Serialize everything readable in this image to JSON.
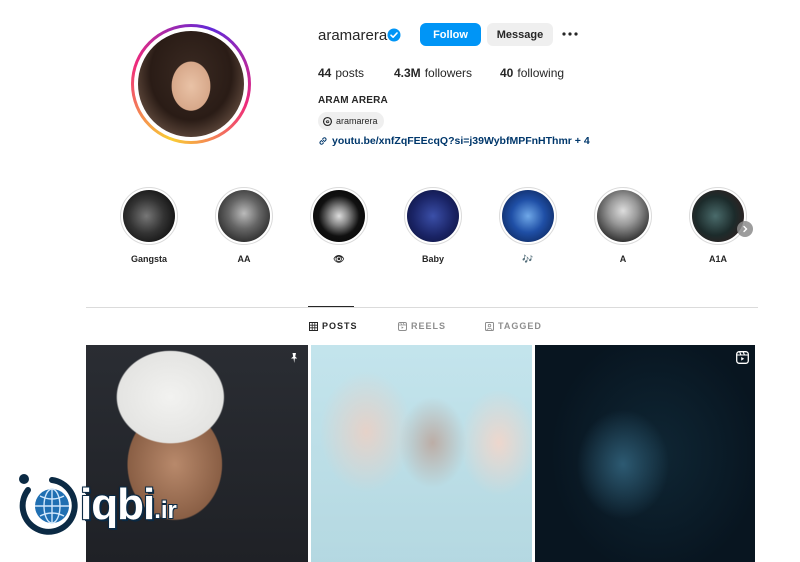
{
  "profile": {
    "username": "aramarera",
    "verified": true,
    "follow_label": "Follow",
    "message_label": "Message",
    "stats": {
      "posts_count": "44",
      "posts_label": "posts",
      "followers_count": "4.3M",
      "followers_label": "followers",
      "following_count": "40",
      "following_label": "following"
    },
    "full_name": "ARAM ARERA",
    "threads_handle": "aramarera",
    "bio_link": "youtu.be/xnfZqFEEcqQ?si=j39WybfMPFnHThmr + 4"
  },
  "highlights": [
    {
      "label": "Gangsta"
    },
    {
      "label": "AA"
    },
    {
      "label": "👁"
    },
    {
      "label": "Baby"
    },
    {
      "label": "🎶"
    },
    {
      "label": "A"
    },
    {
      "label": "A1A"
    }
  ],
  "tabs": [
    {
      "label": "POSTS",
      "active": true
    },
    {
      "label": "REELS",
      "active": false
    },
    {
      "label": "TAGGED",
      "active": false
    }
  ],
  "watermark": {
    "name": "iqbi",
    "suffix": ".ir"
  },
  "colors": {
    "accent": "#0095f6",
    "link": "#00376b",
    "verified": "#0095f6"
  }
}
